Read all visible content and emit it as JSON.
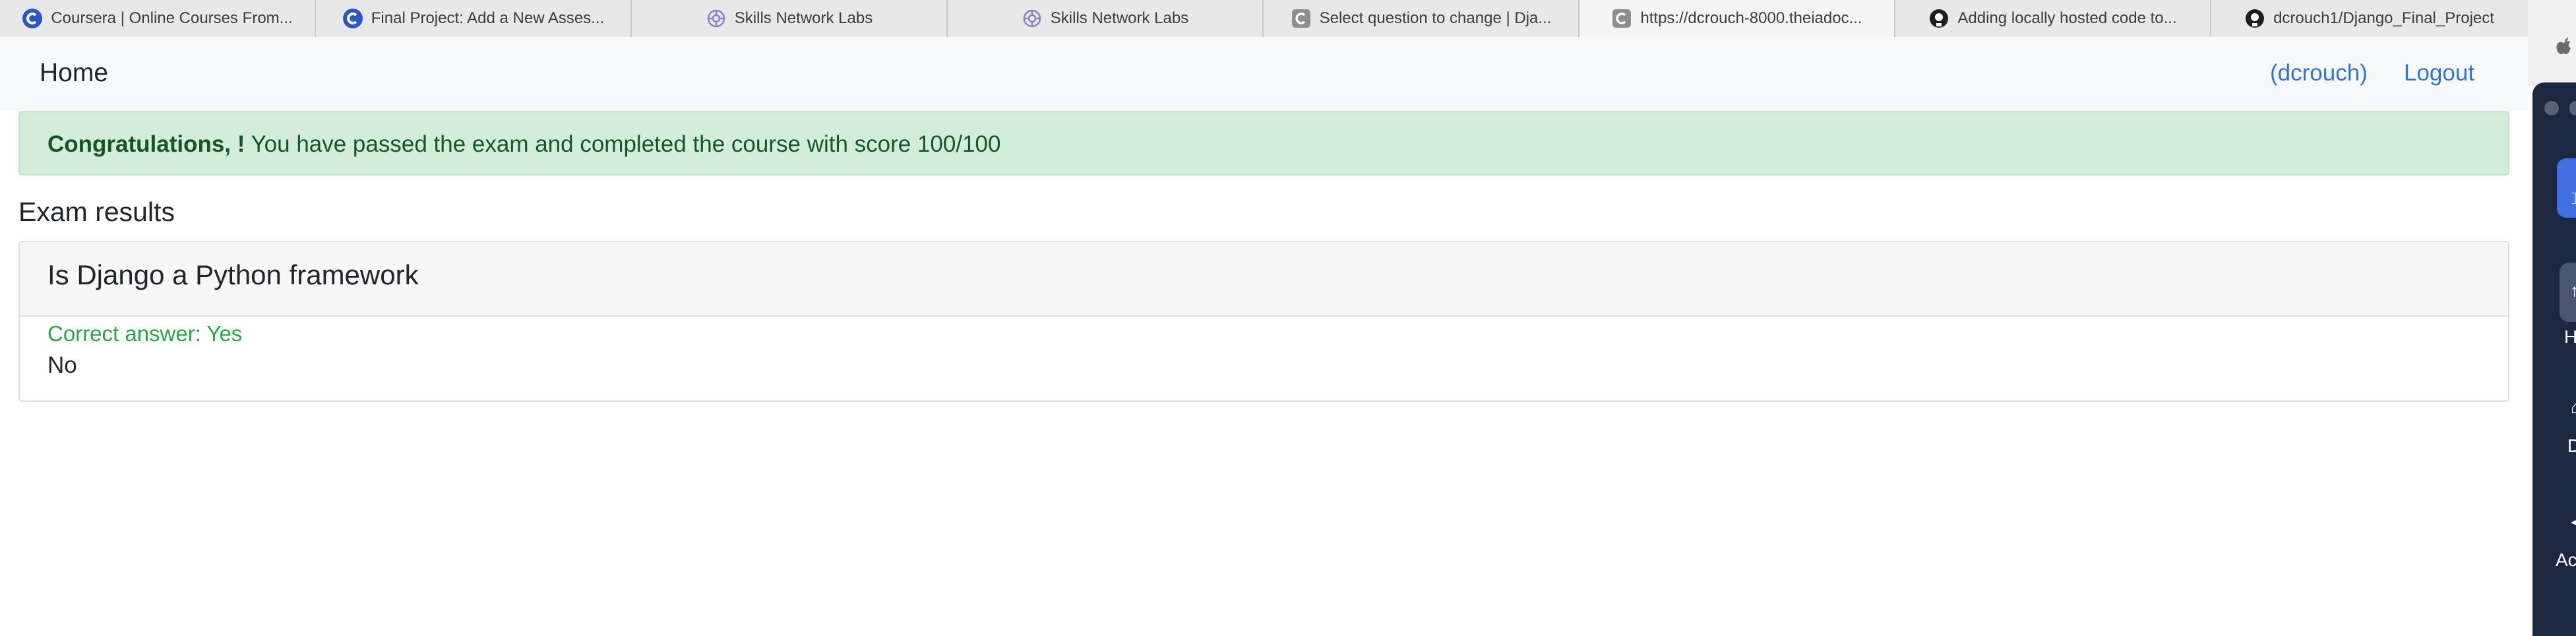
{
  "tabs": [
    {
      "label": "Coursera | Online Courses From...",
      "icon": "coursera-icon",
      "active": false
    },
    {
      "label": "Final Project: Add a New Asses...",
      "icon": "coursera-icon",
      "active": false
    },
    {
      "label": "Skills Network Labs",
      "icon": "skills-network-icon",
      "active": false
    },
    {
      "label": "Skills Network Labs",
      "icon": "skills-network-icon",
      "active": false
    },
    {
      "label": "Select question to change | Dja...",
      "icon": "generic-c-icon",
      "active": false
    },
    {
      "label": "https://dcrouch-8000.theiadoc...",
      "icon": "generic-c-icon",
      "active": true
    },
    {
      "label": "Adding locally hosted code to...",
      "icon": "github-icon",
      "active": false
    },
    {
      "label": "dcrouch1/Django_Final_Project",
      "icon": "github-icon",
      "active": false
    }
  ],
  "navbar": {
    "brand": "Home",
    "user_link": "(dcrouch)",
    "logout_link": "Logout"
  },
  "alert": {
    "bold": "Congratulations, !",
    "message": " You have passed the exam and completed the course with score 100/100"
  },
  "results": {
    "title": "Exam results",
    "question": "Is Django a Python framework",
    "correct_answer": "Correct answer: Yes",
    "choice": "No"
  },
  "side_panel": {
    "label_1": "H",
    "label_2": "D",
    "label_3": "Ac"
  },
  "colors": {
    "link": "#2f74e0",
    "alert_bg": "#d4edda",
    "alert_text": "#155724",
    "correct": "#28a745",
    "side_panel": "#1c2740"
  }
}
